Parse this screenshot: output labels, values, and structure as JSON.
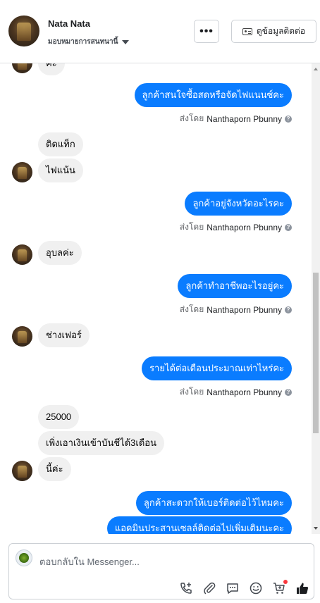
{
  "header": {
    "name": "Nata Nata",
    "assign_label": "มอบหมายการสนทนานี้",
    "more_label": "•••",
    "contact_button_label": "ดูข้อมูลติดต่อ"
  },
  "messages": [
    {
      "dir": "in",
      "text": "ค่ะ",
      "avatar": true
    },
    {
      "dir": "out",
      "text": "ลูกค้าสนใจซื้อสดหรือจัดไฟแนนซ์คะ",
      "sent_by": "ส่งโดย",
      "sender": "Nanthaporn Pbunny"
    },
    {
      "dir": "in",
      "text": "ติดแท็ก",
      "avatar": false
    },
    {
      "dir": "in",
      "text": "ไฟแน้น",
      "avatar": true
    },
    {
      "dir": "out",
      "text": "ลูกค้าอยู่จังหวัดอะไรคะ",
      "sent_by": "ส่งโดย",
      "sender": "Nanthaporn Pbunny"
    },
    {
      "dir": "in",
      "text": "อุบลค่ะ",
      "avatar": true
    },
    {
      "dir": "out",
      "text": "ลูกค้าทำอาชีพอะไรอยู่คะ",
      "sent_by": "ส่งโดย",
      "sender": "Nanthaporn Pbunny"
    },
    {
      "dir": "in",
      "text": "ช่างเฟอร์",
      "avatar": true
    },
    {
      "dir": "out",
      "text": "รายได้ต่อเดือนประมาณเท่าไหร่คะ",
      "sent_by": "ส่งโดย",
      "sender": "Nanthaporn Pbunny"
    },
    {
      "dir": "in",
      "text": "25000",
      "avatar": false
    },
    {
      "dir": "in",
      "text": "เพิ่งเอาเงินเข้าบันชีได้3เดือน",
      "avatar": false
    },
    {
      "dir": "in",
      "text": "นี้ค่ะ",
      "avatar": true
    },
    {
      "dir": "out",
      "text": "ลูกค้าสะดวกให้เบอร์ติดต่อไว้ไหมคะ"
    },
    {
      "dir": "out",
      "text": "แอดมินประสานเซลล์ติดต่อไปเพิ่มเติมนะคะ"
    }
  ],
  "composer": {
    "placeholder": "ตอบกลับใน Messenger...",
    "tools": [
      "call-add-icon",
      "attachment-icon",
      "saved-reply-icon",
      "emoji-icon",
      "cart-icon",
      "like-icon"
    ]
  },
  "colors": {
    "outgoing_bubble": "#0a7cff",
    "incoming_bubble": "#f0f0f0"
  }
}
